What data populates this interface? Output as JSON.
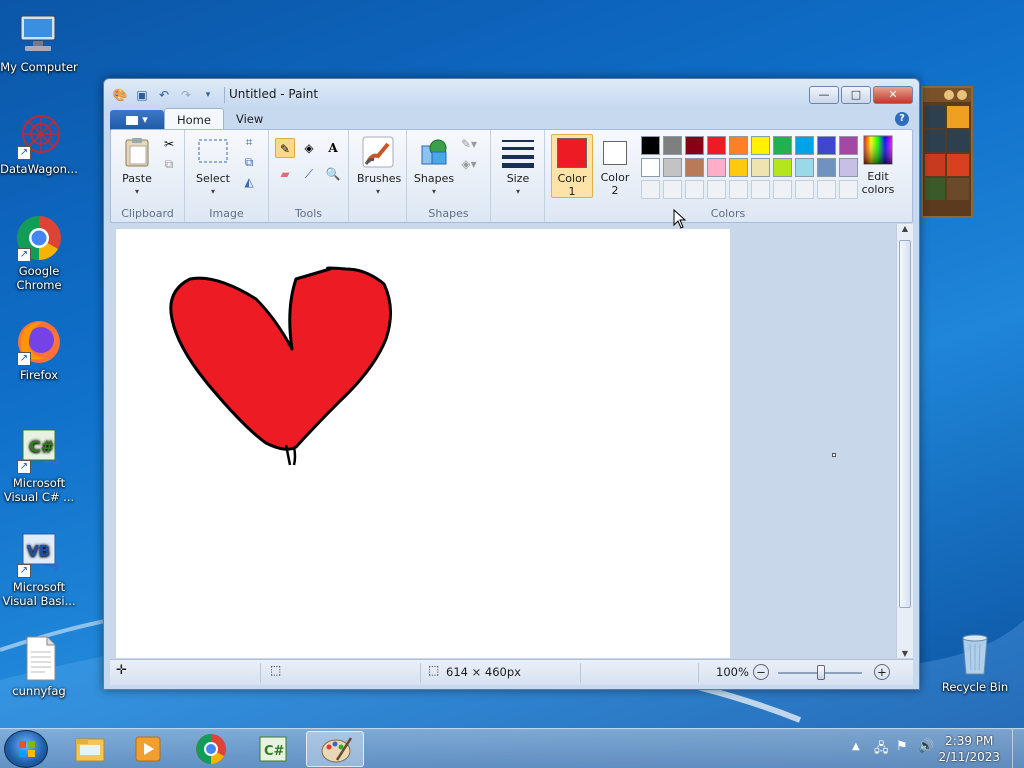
{
  "desktop": {
    "icons": [
      {
        "label": "My Computer"
      },
      {
        "label": "DataWagon..."
      },
      {
        "label": "Google Chrome"
      },
      {
        "label": "Firefox"
      },
      {
        "label": "Microsoft Visual C# ..."
      },
      {
        "label": "Microsoft Visual Basi..."
      },
      {
        "label": "cunnyfag"
      },
      {
        "label": "Recycle Bin"
      }
    ]
  },
  "window": {
    "title": "Untitled - Paint",
    "controls": {
      "minimize": "—",
      "maximize": "□",
      "close": "✕"
    }
  },
  "ribbon": {
    "app_menu": "▾",
    "tabs": [
      "Home",
      "View"
    ],
    "help": "?",
    "groups": {
      "clipboard": {
        "label": "Clipboard",
        "paste": "Paste"
      },
      "image": {
        "label": "Image",
        "select": "Select"
      },
      "tools": {
        "label": "Tools"
      },
      "brushes": {
        "label": "Brushes"
      },
      "shapes": {
        "label": "Shapes",
        "shapes_btn": "Shapes"
      },
      "size": {
        "label": "Size"
      },
      "colors": {
        "label": "Colors",
        "color1": "Color\n1",
        "color2": "Color\n2",
        "color1_value": "#ed1c24",
        "color2_value": "#ffffff",
        "edit": "Edit colors",
        "palette_row1": [
          "#000000",
          "#7f7f7f",
          "#880015",
          "#ed1c24",
          "#ff7f27",
          "#fff200",
          "#22b14c",
          "#00a2e8",
          "#3f48cc",
          "#a349a4"
        ],
        "palette_row2": [
          "#ffffff",
          "#c3c3c3",
          "#b97a57",
          "#ffaec9",
          "#ffc90e",
          "#efe4b0",
          "#b5e61d",
          "#99d9ea",
          "#7092be",
          "#c8bfe7"
        ]
      }
    }
  },
  "canvas": {
    "drawing_fill": "#ed1c24"
  },
  "status": {
    "size": "614 × 460px",
    "zoom": "100%",
    "zoom_out": "−",
    "zoom_in": "+"
  },
  "taskbar": {
    "time": "2:39 PM",
    "date": "2/11/2023"
  }
}
